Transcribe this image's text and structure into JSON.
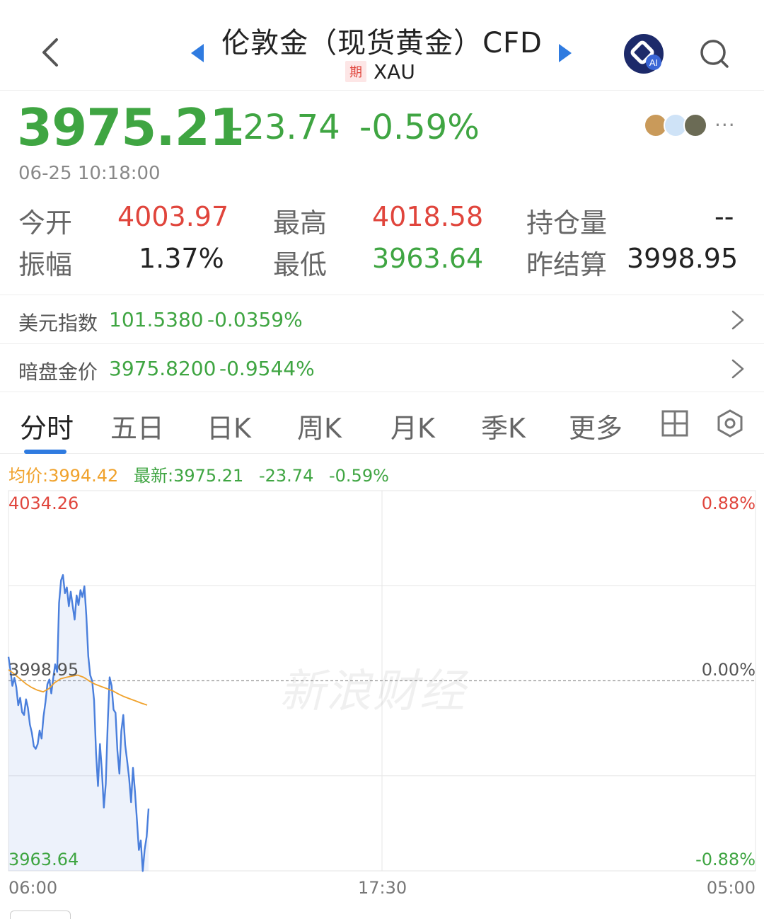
{
  "header": {
    "title": "伦敦金（现货黄金）CFD",
    "tag": "期",
    "code": "XAU"
  },
  "quote": {
    "price": "3975.21",
    "change": "-23.74",
    "change_pct": "-0.59%",
    "time": "06-25 10:18:00",
    "more": "···"
  },
  "stats": {
    "open_label": "今开",
    "open": "4003.97",
    "high_label": "最高",
    "high": "4018.58",
    "oi_label": "持仓量",
    "oi": "--",
    "amp_label": "振幅",
    "amp": "1.37%",
    "low_label": "最低",
    "low": "3963.64",
    "prev_label": "昨结算",
    "prev": "3998.95"
  },
  "related": [
    {
      "name": "美元指数",
      "value": "101.5380",
      "pct": "-0.0359%"
    },
    {
      "name": "暗盘金价",
      "value": "3975.8200",
      "pct": "-0.9544%"
    }
  ],
  "tabs": [
    "分时",
    "五日",
    "日K",
    "周K",
    "月K",
    "季K",
    "更多"
  ],
  "legend": {
    "avg": "均价:3994.42",
    "latest": "最新:3975.21",
    "change": "-23.74",
    "pct": "-0.59%"
  },
  "watermark": "新浪财经",
  "colors": {
    "up": "#e0453c",
    "down": "#3fa542",
    "accent": "#2f7be0",
    "avg_line": "#f0a22c"
  },
  "chart_data": {
    "type": "line",
    "x_ticks": [
      "06:00",
      "17:30",
      "05:00"
    ],
    "y_ticks_left": [
      "4034.26",
      "3998.95",
      "3963.64"
    ],
    "y_ticks_right": [
      "0.88%",
      "0.00%",
      "-0.88%"
    ],
    "ylim": [
      3963.64,
      4034.26
    ],
    "baseline": 3998.95,
    "total_points": 1380,
    "series": [
      {
        "name": "最新",
        "values": [
          4003.4,
          4000.9,
          3998.0,
          3999.5,
          3997.8,
          3994.4,
          3995.8,
          3993.1,
          3992.6,
          3995.5,
          3993.9,
          3990.8,
          3989.3,
          3986.8,
          3986.3,
          3987.2,
          3989.7,
          3988.2,
          3992.3,
          3995.0,
          3998.3,
          3999.2,
          3996.6,
          3999.5,
          4002.0,
          4000.6,
          4013.4,
          4017.6,
          4018.6,
          4015.2,
          4016.3,
          4012.8,
          4015.5,
          4012.8,
          4010.3,
          4014.8,
          4013.0,
          4015.8,
          4014.5,
          4016.5,
          4011.1,
          4003.5,
          4000.0,
          3998.9,
          3995.3,
          3985.5,
          3979.4,
          3987.2,
          3982.3,
          3975.4,
          3979.8,
          3991.1,
          3999.6,
          3998.0,
          3993.6,
          3993.0,
          3985.9,
          3981.7,
          3989.6,
          3992.6,
          3987.0,
          3984.0,
          3980.9,
          3976.4,
          3982.8,
          3978.4,
          3973.2,
          3967.5,
          3969.3,
          3963.6,
          3967.6,
          3970.0,
          3975.2
        ],
        "color": "#4a7fdc"
      },
      {
        "name": "均价",
        "values": [
          4001.0,
          4000.2,
          3999.3,
          3998.4,
          3997.7,
          3997.2,
          3996.9,
          3997.5,
          3998.6,
          3999.3,
          3999.6,
          3999.8,
          4000.0,
          3999.6,
          3998.9,
          3998.3,
          3997.9,
          3997.5,
          3997.1,
          3996.5,
          3996.0,
          3995.6,
          3995.2,
          3994.8,
          3994.42
        ],
        "color": "#f0a22c"
      }
    ]
  }
}
